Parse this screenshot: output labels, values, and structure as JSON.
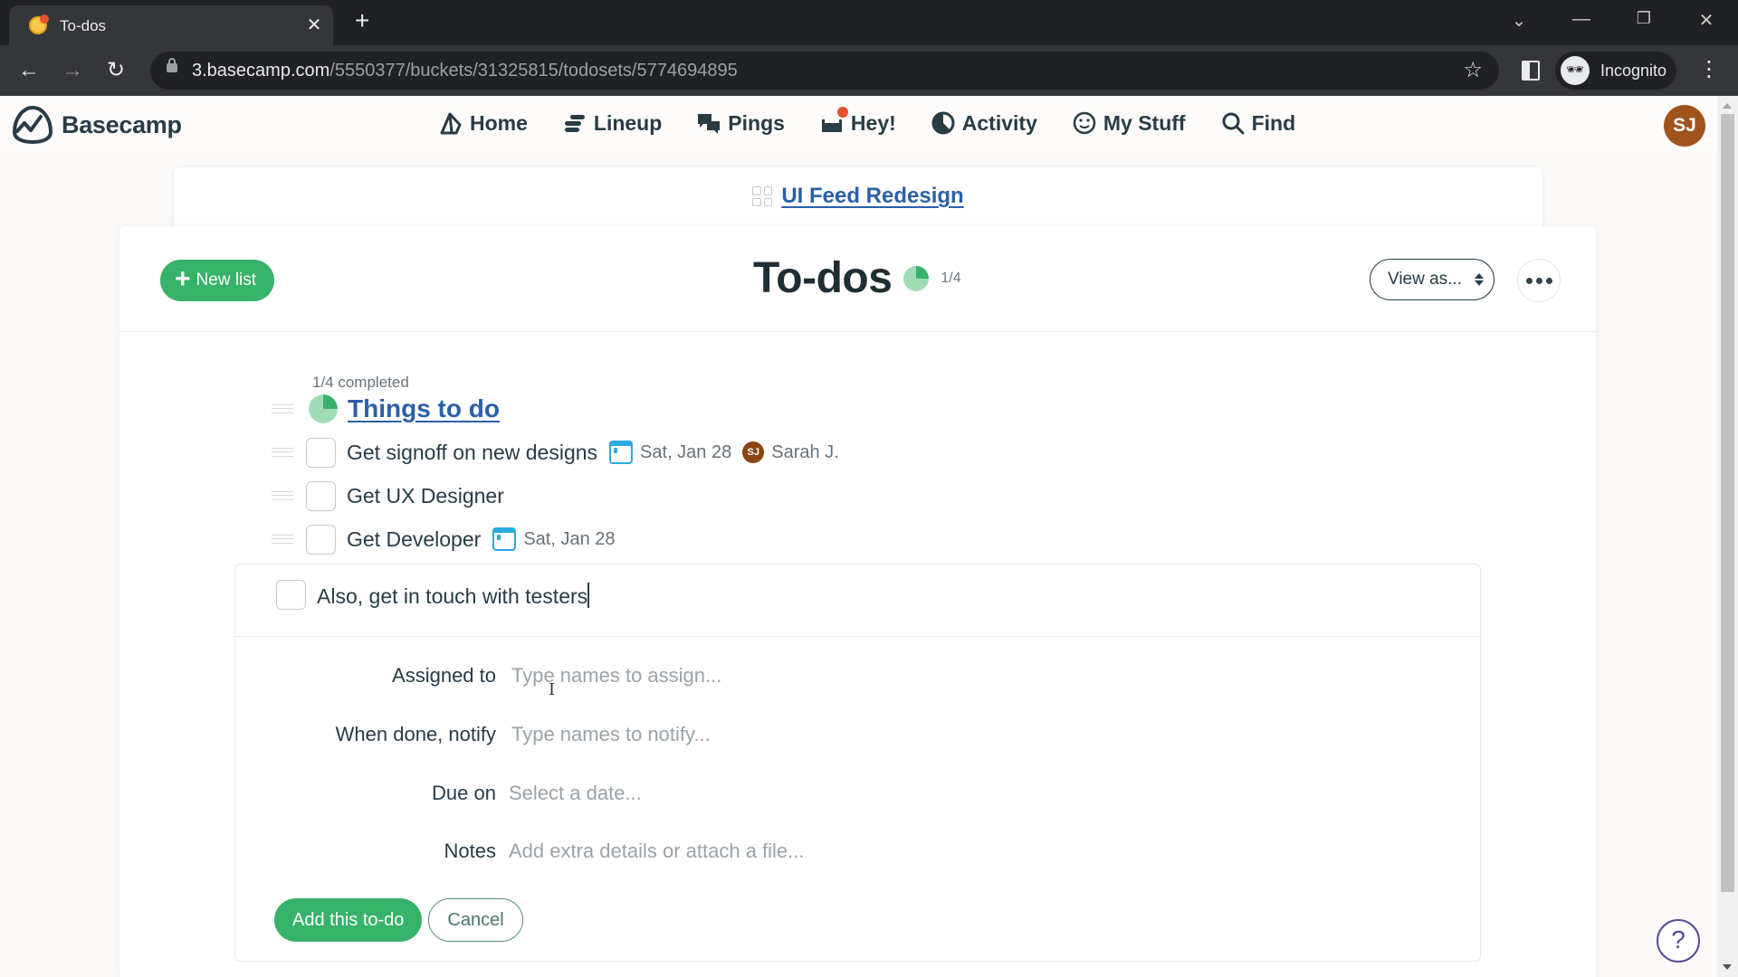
{
  "browser": {
    "tab_title": "To-dos",
    "url_host": "3.basecamp.com",
    "url_path": "/5550377/buckets/31325815/todosets/5774694895",
    "profile_label": "Incognito"
  },
  "app": {
    "brand": "Basecamp",
    "nav": [
      {
        "label": "Home",
        "icon": "home-icon"
      },
      {
        "label": "Lineup",
        "icon": "lineup-icon"
      },
      {
        "label": "Pings",
        "icon": "pings-icon"
      },
      {
        "label": "Hey!",
        "icon": "hey-icon",
        "has_notification": true
      },
      {
        "label": "Activity",
        "icon": "activity-icon"
      },
      {
        "label": "My Stuff",
        "icon": "my-stuff-icon"
      },
      {
        "label": "Find",
        "icon": "search-icon"
      }
    ],
    "user_initials": "SJ",
    "colors": {
      "accent_green": "#36b26a",
      "link_blue": "#2c5fa8",
      "avatar_brown": "#a0541d"
    }
  },
  "breadcrumb": {
    "project": "UI Feed Redesign"
  },
  "page": {
    "title": "To-dos",
    "progress": "1/4",
    "progress_fraction": 0.25,
    "new_list_label": "New list",
    "view_as_label": "View as..."
  },
  "list": {
    "completed_text": "1/4 completed",
    "progress_fraction": 0.25,
    "title": "Things to do",
    "todos": [
      {
        "text": "Get signoff on new designs",
        "due": "Sat, Jan 28",
        "assignee_initials": "SJ",
        "assignee": "Sarah J."
      },
      {
        "text": "Get UX Designer",
        "due": null,
        "assignee": null
      },
      {
        "text": "Get Developer",
        "due": "Sat, Jan 28",
        "assignee": null
      }
    ]
  },
  "new_todo": {
    "value": "Also, get in touch with testers",
    "fields": [
      {
        "label": "Assigned to",
        "placeholder": "Type names to assign..."
      },
      {
        "label": "When done, notify",
        "placeholder": "Type names to notify..."
      },
      {
        "label": "Due on",
        "placeholder": "Select a date..."
      },
      {
        "label": "Notes",
        "placeholder": "Add extra details or attach a file..."
      }
    ],
    "submit_label": "Add this to-do",
    "cancel_label": "Cancel"
  },
  "help": {
    "label": "?"
  }
}
